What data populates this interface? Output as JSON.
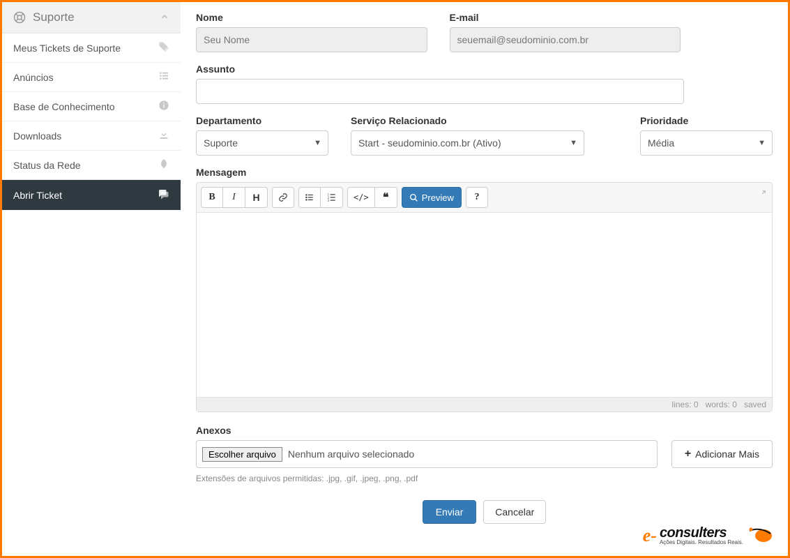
{
  "sidebar": {
    "title": "Suporte",
    "items": [
      {
        "label": "Meus Tickets de Suporte",
        "icon": "tags-icon"
      },
      {
        "label": "Anúncios",
        "icon": "list-icon"
      },
      {
        "label": "Base de Conhecimento",
        "icon": "info-icon"
      },
      {
        "label": "Downloads",
        "icon": "download-icon"
      },
      {
        "label": "Status da Rede",
        "icon": "rocket-icon"
      },
      {
        "label": "Abrir Ticket",
        "icon": "chat-icon"
      }
    ]
  },
  "form": {
    "name_label": "Nome",
    "name_value": "Seu Nome",
    "email_label": "E-mail",
    "email_value": "seuemail@seudominio.com.br",
    "subject_label": "Assunto",
    "subject_value": "",
    "department_label": "Departamento",
    "department_value": "Suporte",
    "service_label": "Serviço Relacionado",
    "service_value": "Start - seudominio.com.br (Ativo)",
    "priority_label": "Prioridade",
    "priority_value": "Média",
    "message_label": "Mensagem"
  },
  "editor": {
    "preview_label": "Preview",
    "status_lines": "lines: 0",
    "status_words": "words: 0",
    "status_saved": "saved"
  },
  "attachments": {
    "label": "Anexos",
    "choose_label": "Escolher arquivo",
    "none_selected": "Nenhum arquivo selecionado",
    "add_more": "Adicionar Mais",
    "ext_text": "Extensões de arquivos permitidas: .jpg, .gif, .jpeg, .png, .pdf"
  },
  "actions": {
    "submit": "Enviar",
    "cancel": "Cancelar"
  },
  "branding": {
    "name": "consulters",
    "tagline": "Ações Digitais. Resultados Reais."
  }
}
